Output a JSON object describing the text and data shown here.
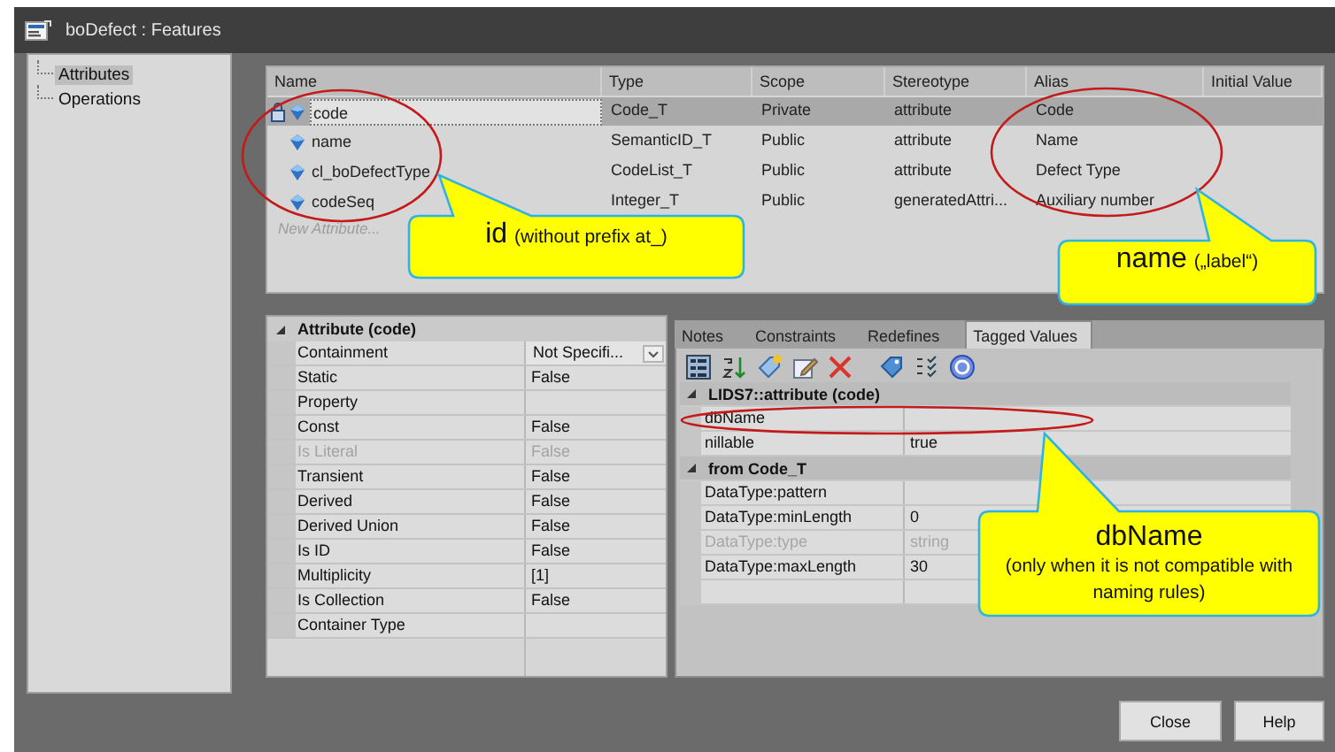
{
  "window": {
    "title": "boDefect : Features"
  },
  "tree": {
    "items": [
      {
        "label": "Attributes",
        "selected": true
      },
      {
        "label": "Operations",
        "selected": false
      }
    ]
  },
  "features_table": {
    "columns": [
      "Name",
      "Type",
      "Scope",
      "Stereotype",
      "Alias",
      "Initial Value"
    ],
    "rows": [
      {
        "name": "code",
        "type": "Code_T",
        "scope": "Private",
        "stereotype": "attribute",
        "alias": "Code",
        "locked": true,
        "selected": true
      },
      {
        "name": "name",
        "type": "SemanticID_T",
        "scope": "Public",
        "stereotype": "attribute",
        "alias": "Name",
        "locked": false,
        "selected": false
      },
      {
        "name": "cl_boDefectType",
        "type": "CodeList_T",
        "scope": "Public",
        "stereotype": "attribute",
        "alias": "Defect Type",
        "locked": false,
        "selected": false
      },
      {
        "name": "codeSeq",
        "type": "Integer_T",
        "scope": "Public",
        "stereotype": "generatedAttri...",
        "alias": "Auxiliary number",
        "locked": false,
        "selected": false
      }
    ],
    "placeholder": "New Attribute..."
  },
  "properties": {
    "title": "Attribute (code)",
    "expanded": true,
    "rows": [
      {
        "label": "Containment",
        "value": "Not Specifi...",
        "kind": "dropdown",
        "disabled": false
      },
      {
        "label": "Static",
        "value": "False",
        "kind": "text",
        "disabled": false
      },
      {
        "label": "Property",
        "kind": "text",
        "disabled": false
      },
      {
        "label": "Const",
        "value": "False",
        "kind": "text",
        "disabled": false
      },
      {
        "label": "Is Literal",
        "value": "False",
        "kind": "text",
        "disabled": true
      },
      {
        "label": "Transient",
        "value": "False",
        "kind": "text",
        "disabled": false
      },
      {
        "label": "Derived",
        "value": "False",
        "kind": "text",
        "disabled": false
      },
      {
        "label": "Derived Union",
        "value": "False",
        "kind": "text",
        "disabled": false
      },
      {
        "label": "Is ID",
        "value": "False",
        "kind": "text",
        "disabled": false
      },
      {
        "label": "Multiplicity",
        "value": "[1]",
        "kind": "text",
        "disabled": false
      },
      {
        "label": "Is Collection",
        "value": "False",
        "kind": "text",
        "disabled": false
      },
      {
        "label": "Container Type",
        "kind": "text",
        "disabled": false
      }
    ]
  },
  "tabs": [
    {
      "label": "Notes",
      "selected": false
    },
    {
      "label": "Constraints",
      "selected": false
    },
    {
      "label": "Redefines",
      "selected": false
    },
    {
      "label": "Tagged Values",
      "selected": true
    }
  ],
  "tagged_values": {
    "groups": [
      {
        "title": "LIDS7::attribute (code)",
        "expanded": true,
        "rows": [
          {
            "label": "dbName",
            "disabled": false
          },
          {
            "label": "nillable",
            "value": "true",
            "disabled": false
          }
        ]
      },
      {
        "title": "from Code_T",
        "expanded": true,
        "rows": [
          {
            "label": "DataType:pattern",
            "disabled": false
          },
          {
            "label": "DataType:minLength",
            "value": "0",
            "disabled": false
          },
          {
            "label": "DataType:type",
            "value": "string",
            "disabled": true
          },
          {
            "label": "DataType:maxLength",
            "value": "30",
            "disabled": false
          }
        ]
      }
    ]
  },
  "callouts": [
    {
      "title": "id",
      "note": "(without prefix at_)"
    },
    {
      "title": "name",
      "note": "(„label“)"
    },
    {
      "title": "dbName",
      "note": "(only when it is not compatible with naming rules)"
    }
  ],
  "buttons": [
    "Close",
    "Help"
  ]
}
